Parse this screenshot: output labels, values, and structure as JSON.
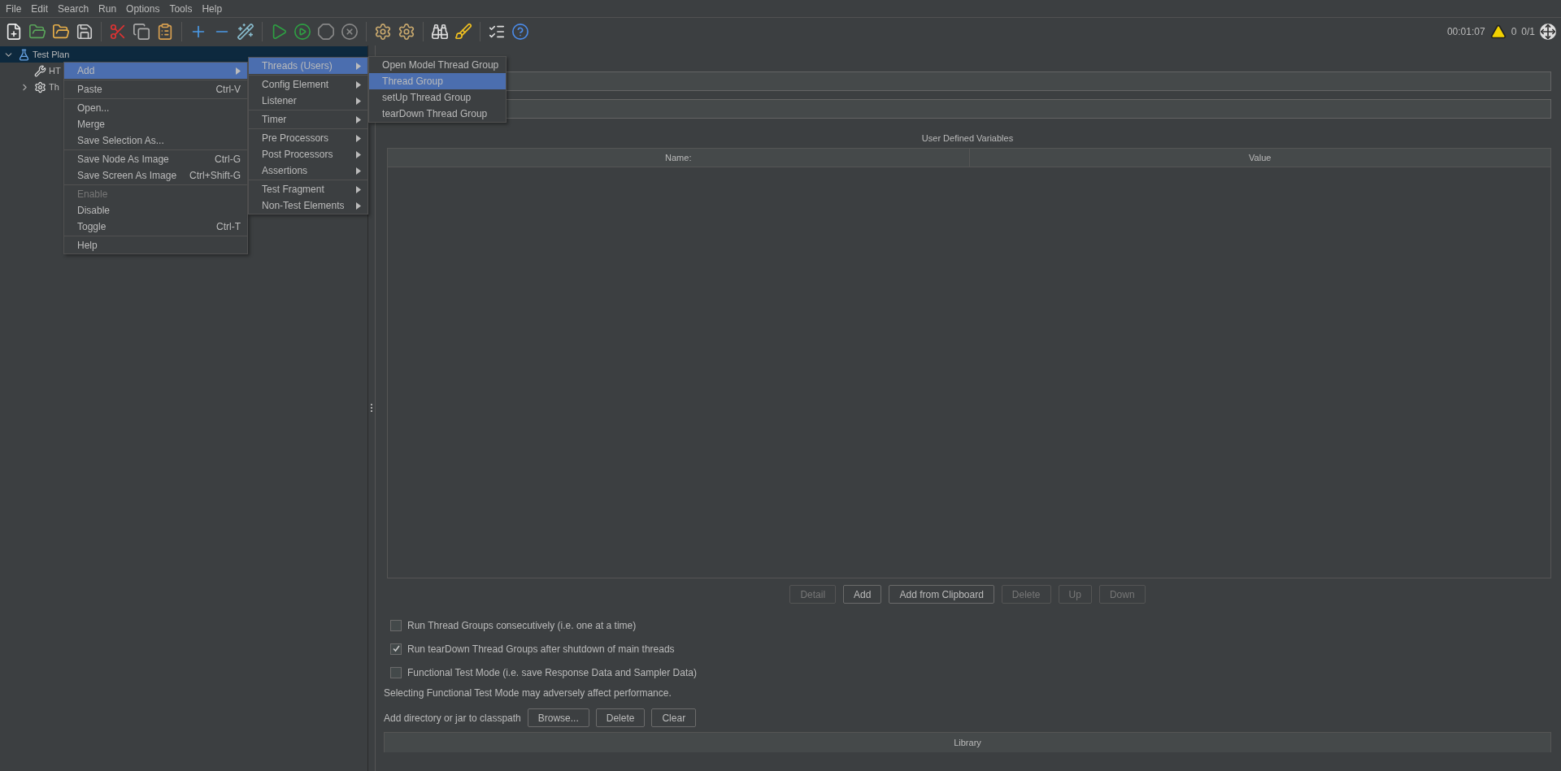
{
  "menubar": [
    "File",
    "Edit",
    "Search",
    "Run",
    "Options",
    "Tools",
    "Help"
  ],
  "status": {
    "elapsed": "00:01:07",
    "warnings": "0",
    "threads": "0/1"
  },
  "tree": [
    {
      "label": "Test Plan",
      "selected": true,
      "expanded": true,
      "children": [
        {
          "label": "HT",
          "selected": false
        },
        {
          "label": "Th",
          "selected": false,
          "expanded": false
        }
      ]
    }
  ],
  "context_menu": [
    [
      {
        "label": "Add",
        "selected": true,
        "disabled": false,
        "submenu": true
      }
    ],
    [
      {
        "label": "Paste",
        "shortcut": "Ctrl-V",
        "selected": false,
        "disabled": false,
        "submenu": false
      }
    ],
    [
      {
        "label": "Open...",
        "selected": false,
        "disabled": false,
        "submenu": false
      },
      {
        "label": "Merge",
        "selected": false,
        "disabled": false,
        "submenu": false
      },
      {
        "label": "Save Selection As...",
        "selected": false,
        "disabled": false,
        "submenu": false
      }
    ],
    [
      {
        "label": "Save Node As Image",
        "shortcut": "Ctrl-G",
        "selected": false,
        "disabled": false,
        "submenu": false
      },
      {
        "label": "Save Screen As Image",
        "shortcut": "Ctrl+Shift-G",
        "selected": false,
        "disabled": false,
        "submenu": false
      }
    ],
    [
      {
        "label": "Enable",
        "selected": false,
        "disabled": true,
        "submenu": false
      },
      {
        "label": "Disable",
        "selected": false,
        "disabled": false,
        "submenu": false
      },
      {
        "label": "Toggle",
        "shortcut": "Ctrl-T",
        "selected": false,
        "disabled": false,
        "submenu": false
      }
    ],
    [
      {
        "label": "Help",
        "selected": false,
        "disabled": false,
        "submenu": false
      }
    ]
  ],
  "add_submenu": [
    [
      {
        "label": "Threads (Users)",
        "selected": true,
        "disabled": false,
        "submenu": true
      }
    ],
    [
      {
        "label": "Config Element",
        "selected": false,
        "disabled": false,
        "submenu": true
      },
      {
        "label": "Listener",
        "selected": false,
        "disabled": false,
        "submenu": true
      }
    ],
    [
      {
        "label": "Timer",
        "selected": false,
        "disabled": false,
        "submenu": true
      }
    ],
    [
      {
        "label": "Pre Processors",
        "selected": false,
        "disabled": false,
        "submenu": true
      },
      {
        "label": "Post Processors",
        "selected": false,
        "disabled": false,
        "submenu": true
      },
      {
        "label": "Assertions",
        "selected": false,
        "disabled": false,
        "submenu": true
      }
    ],
    [
      {
        "label": "Test Fragment",
        "selected": false,
        "disabled": false,
        "submenu": true
      },
      {
        "label": "Non-Test Elements",
        "selected": false,
        "disabled": false,
        "submenu": true
      }
    ]
  ],
  "threads_submenu": [
    [
      {
        "label": "Open Model Thread Group",
        "selected": false,
        "disabled": false,
        "submenu": false
      },
      {
        "label": "Thread Group",
        "selected": true,
        "disabled": false,
        "submenu": false
      },
      {
        "label": "setUp Thread Group",
        "selected": false,
        "disabled": false,
        "submenu": false
      },
      {
        "label": "tearDown Thread Group",
        "selected": false,
        "disabled": false,
        "submenu": false
      }
    ]
  ],
  "variables": {
    "title": "User Defined Variables",
    "columns": [
      "Name:",
      "Value"
    ]
  },
  "table_buttons": [
    {
      "label": "Detail",
      "disabled": true
    },
    {
      "label": "Add",
      "disabled": false
    },
    {
      "label": "Add from Clipboard",
      "disabled": false
    },
    {
      "label": "Delete",
      "disabled": true
    },
    {
      "label": "Up",
      "disabled": true
    },
    {
      "label": "Down",
      "disabled": true
    }
  ],
  "options": [
    {
      "label": "Run Thread Groups consecutively (i.e. one at a time)",
      "checked": false
    },
    {
      "label": "Run tearDown Thread Groups after shutdown of main threads",
      "checked": true
    },
    {
      "label": "Functional Test Mode (i.e. save Response Data and Sampler Data)",
      "checked": false
    }
  ],
  "note": "Selecting Functional Test Mode may adversely affect performance.",
  "classpath": {
    "label": "Add directory or jar to classpath",
    "buttons": [
      {
        "label": "Browse...",
        "disabled": false
      },
      {
        "label": "Delete",
        "disabled": false
      },
      {
        "label": "Clear",
        "disabled": false
      }
    ]
  },
  "library": {
    "columns": [
      "Library"
    ]
  }
}
